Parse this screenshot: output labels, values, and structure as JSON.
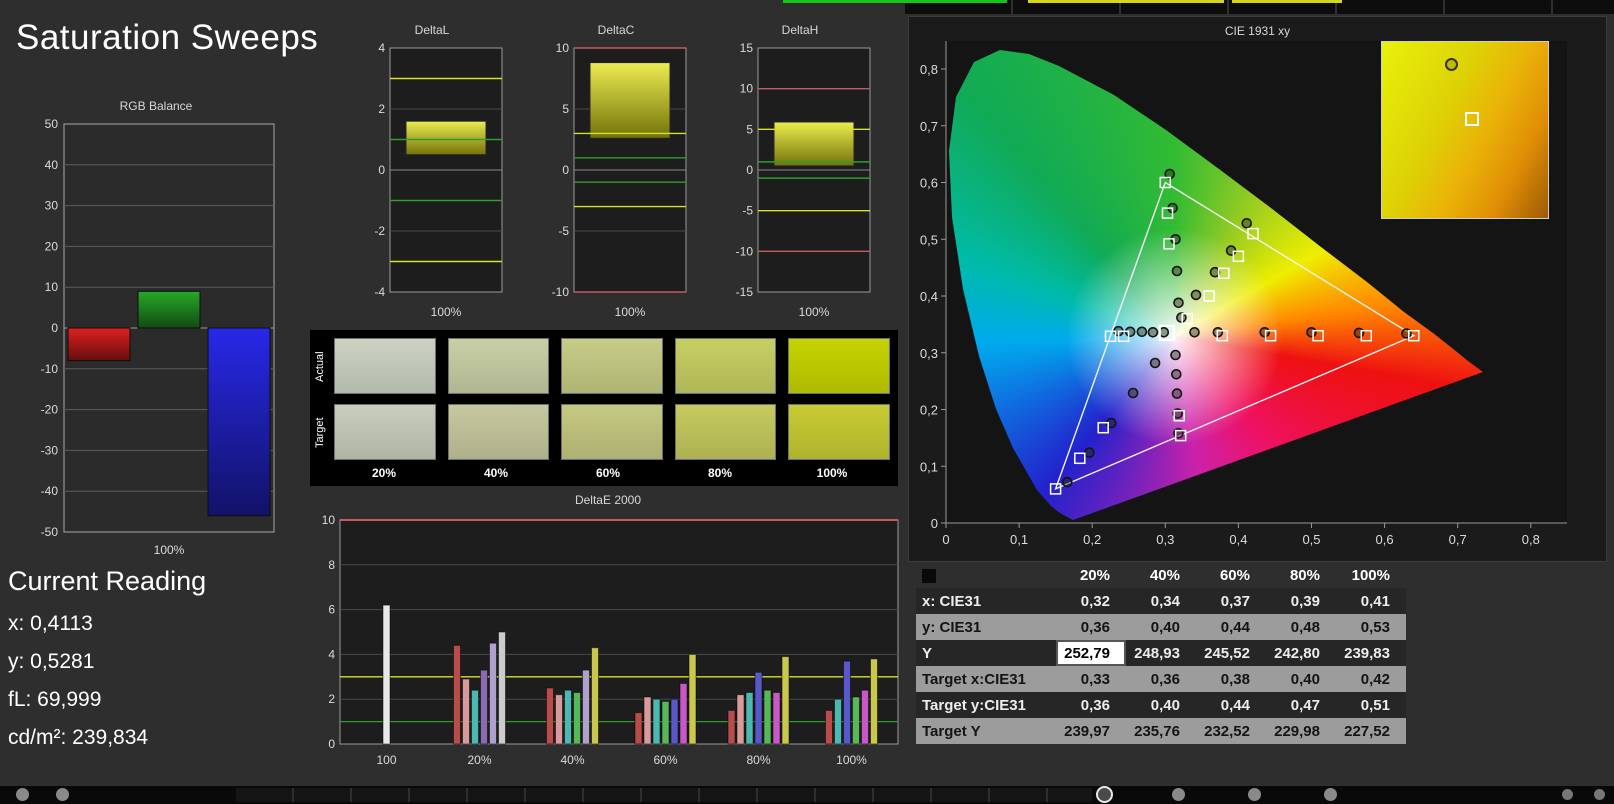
{
  "page": {
    "title": "Saturation Sweeps"
  },
  "current_reading": {
    "heading": "Current Reading",
    "lines": [
      "x: 0,4113",
      "y: 0,5281",
      "fL: 69,999",
      "cd/m²: 239,834"
    ]
  },
  "chart_data": [
    {
      "type": "bar",
      "title": "RGB Balance",
      "categories": [
        "Red",
        "Green",
        "Blue"
      ],
      "values": [
        -8,
        9,
        -46
      ],
      "colors": [
        "#e02020",
        "#28a828",
        "#2828e8"
      ],
      "ylim": [
        -50,
        50
      ],
      "ytick": 10,
      "xlabel": "100%"
    },
    {
      "type": "range-bar",
      "title": "DeltaL",
      "ylim": [
        -4,
        4
      ],
      "ytick": 2,
      "bar": [
        0.5,
        1.6
      ],
      "refs": [
        {
          "value": 3,
          "color": "yellow"
        },
        {
          "value": -3,
          "color": "yellow"
        },
        {
          "value": 1,
          "color": "green"
        },
        {
          "value": -1,
          "color": "green"
        }
      ],
      "xlabel": "100%"
    },
    {
      "type": "range-bar",
      "title": "DeltaC",
      "ylim": [
        -10,
        10
      ],
      "ytick": 5,
      "bar": [
        2.6,
        8.8
      ],
      "refs": [
        {
          "value": 10,
          "color": "red"
        },
        {
          "value": -10,
          "color": "red"
        },
        {
          "value": 3,
          "color": "yellow"
        },
        {
          "value": -3,
          "color": "yellow"
        },
        {
          "value": 1,
          "color": "green"
        },
        {
          "value": -1,
          "color": "green"
        }
      ],
      "xlabel": "100%"
    },
    {
      "type": "range-bar",
      "title": "DeltaH",
      "ylim": [
        -15,
        15
      ],
      "ytick": 5,
      "bar": [
        0.5,
        5.9
      ],
      "refs": [
        {
          "value": 10,
          "color": "red"
        },
        {
          "value": -10,
          "color": "red"
        },
        {
          "value": 5,
          "color": "yellow"
        },
        {
          "value": -5,
          "color": "yellow"
        },
        {
          "value": 1,
          "color": "green"
        },
        {
          "value": -1,
          "color": "green"
        }
      ],
      "xlabel": "100%"
    },
    {
      "type": "table",
      "title": "Saturation Swatches",
      "row_labels": [
        "Actual",
        "Target"
      ],
      "col_labels": [
        "20%",
        "40%",
        "60%",
        "80%",
        "100%"
      ],
      "actual_colors": [
        "#ccd3c3",
        "#c9cfa5",
        "#c7cd86",
        "#c7cf63",
        "#c6d400"
      ],
      "target_colors": [
        "#c9cdbb",
        "#c6c99e",
        "#c5c981",
        "#c6ca5e",
        "#c7cc33"
      ]
    },
    {
      "type": "bar",
      "title": "DeltaE 2000",
      "ylim": [
        0,
        10
      ],
      "ytick": 2,
      "refs": [
        {
          "value": 10,
          "color": "red"
        },
        {
          "value": 3,
          "color": "yellow"
        },
        {
          "value": 1,
          "color": "green"
        }
      ],
      "groups": [
        {
          "label": "100",
          "bars": [
            {
              "color": "#e8e8e8",
              "value": 6.2
            }
          ]
        },
        {
          "label": "20%",
          "bars": [
            {
              "color": "#b84c4c",
              "value": 4.4
            },
            {
              "color": "#d89b9b",
              "value": 2.9
            },
            {
              "color": "#4cb8b0",
              "value": 2.4
            },
            {
              "color": "#8a6ab0",
              "value": 3.3
            },
            {
              "color": "#b0a0cc",
              "value": 4.5
            },
            {
              "color": "#cccccc",
              "value": 5.0
            }
          ]
        },
        {
          "label": "40%",
          "bars": [
            {
              "color": "#b84c4c",
              "value": 2.5
            },
            {
              "color": "#d89b9b",
              "value": 2.2
            },
            {
              "color": "#4cb8b0",
              "value": 2.4
            },
            {
              "color": "#58b858",
              "value": 2.3
            },
            {
              "color": "#b0a0cc",
              "value": 3.3
            },
            {
              "color": "#c8c84c",
              "value": 4.3
            }
          ]
        },
        {
          "label": "60%",
          "bars": [
            {
              "color": "#b84c4c",
              "value": 1.4
            },
            {
              "color": "#d89b9b",
              "value": 2.1
            },
            {
              "color": "#4cb8b0",
              "value": 2.0
            },
            {
              "color": "#58b858",
              "value": 1.9
            },
            {
              "color": "#5858c8",
              "value": 2.0
            },
            {
              "color": "#c858c8",
              "value": 2.7
            },
            {
              "color": "#c8c84c",
              "value": 4.0
            }
          ]
        },
        {
          "label": "80%",
          "bars": [
            {
              "color": "#b84c4c",
              "value": 1.5
            },
            {
              "color": "#d89b9b",
              "value": 2.2
            },
            {
              "color": "#4cb8b0",
              "value": 2.3
            },
            {
              "color": "#5858c8",
              "value": 3.2
            },
            {
              "color": "#58b858",
              "value": 2.4
            },
            {
              "color": "#c858c8",
              "value": 2.3
            },
            {
              "color": "#c8c84c",
              "value": 3.9
            }
          ]
        },
        {
          "label": "100%",
          "bars": [
            {
              "color": "#b84c4c",
              "value": 1.5
            },
            {
              "color": "#4cb8b0",
              "value": 2.0
            },
            {
              "color": "#5858c8",
              "value": 3.7
            },
            {
              "color": "#58b858",
              "value": 2.1
            },
            {
              "color": "#c858c8",
              "value": 2.4
            },
            {
              "color": "#c8c84c",
              "value": 3.8
            }
          ]
        }
      ]
    },
    {
      "type": "scatter",
      "title": "CIE 1931 xy",
      "xlim": [
        0,
        0.85
      ],
      "ylim": [
        0,
        0.85
      ],
      "xtick_labels": [
        "0",
        "0,1",
        "0,2",
        "0,3",
        "0,4",
        "0,5",
        "0,6",
        "0,7",
        "0,8"
      ],
      "ytick_labels": [
        "0",
        "0,1",
        "0,2",
        "0,3",
        "0,4",
        "0,5",
        "0,6",
        "0,7",
        "0,8"
      ],
      "gamut_triangle": [
        [
          0.64,
          0.33
        ],
        [
          0.3,
          0.6
        ],
        [
          0.15,
          0.06
        ]
      ],
      "measured_points": [
        [
          0.34,
          0.336
        ],
        [
          0.372,
          0.336
        ],
        [
          0.436,
          0.336
        ],
        [
          0.5,
          0.336
        ],
        [
          0.565,
          0.335
        ],
        [
          0.63,
          0.334
        ],
        [
          0.318,
          0.388
        ],
        [
          0.316,
          0.444
        ],
        [
          0.314,
          0.5
        ],
        [
          0.31,
          0.555
        ],
        [
          0.306,
          0.615
        ],
        [
          0.286,
          0.282
        ],
        [
          0.256,
          0.229
        ],
        [
          0.226,
          0.176
        ],
        [
          0.196,
          0.124
        ],
        [
          0.166,
          0.072
        ],
        [
          0.298,
          0.336
        ],
        [
          0.283,
          0.336
        ],
        [
          0.268,
          0.337
        ],
        [
          0.252,
          0.337
        ],
        [
          0.236,
          0.338
        ],
        [
          0.314,
          0.296
        ],
        [
          0.315,
          0.262
        ],
        [
          0.316,
          0.228
        ],
        [
          0.317,
          0.193
        ],
        [
          0.318,
          0.158
        ],
        [
          0.322,
          0.362
        ],
        [
          0.342,
          0.402
        ],
        [
          0.368,
          0.442
        ],
        [
          0.39,
          0.48
        ],
        [
          0.4113,
          0.5281
        ]
      ],
      "target_points": [
        [
          0.378,
          0.33
        ],
        [
          0.444,
          0.33
        ],
        [
          0.509,
          0.33
        ],
        [
          0.575,
          0.33
        ],
        [
          0.64,
          0.33
        ],
        [
          0.305,
          0.492
        ],
        [
          0.303,
          0.546
        ],
        [
          0.3,
          0.6
        ],
        [
          0.215,
          0.168
        ],
        [
          0.183,
          0.114
        ],
        [
          0.15,
          0.06
        ],
        [
          0.243,
          0.329
        ],
        [
          0.225,
          0.329
        ],
        [
          0.319,
          0.189
        ],
        [
          0.321,
          0.154
        ],
        [
          0.33,
          0.36
        ],
        [
          0.36,
          0.4
        ],
        [
          0.38,
          0.44
        ],
        [
          0.4,
          0.47
        ],
        [
          0.42,
          0.51
        ]
      ],
      "current_point": [
        0.302,
        0.335
      ]
    }
  ],
  "measurement_table": {
    "columns": [
      "20%",
      "40%",
      "60%",
      "80%",
      "100%"
    ],
    "rows": [
      {
        "label": "x: CIE31",
        "values": [
          "0,32",
          "0,34",
          "0,37",
          "0,39",
          "0,41"
        ]
      },
      {
        "label": "y: CIE31",
        "values": [
          "0,36",
          "0,40",
          "0,44",
          "0,48",
          "0,53"
        ]
      },
      {
        "label": "Y",
        "values": [
          "252,79",
          "248,93",
          "245,52",
          "242,80",
          "239,83"
        ],
        "highlight_col": 0
      },
      {
        "label": "Target x:CIE31",
        "values": [
          "0,33",
          "0,36",
          "0,38",
          "0,40",
          "0,42"
        ]
      },
      {
        "label": "Target y:CIE31",
        "values": [
          "0,36",
          "0,40",
          "0,44",
          "0,47",
          "0,51"
        ]
      },
      {
        "label": "Target Y",
        "values": [
          "239,97",
          "235,76",
          "232,52",
          "229,98",
          "227,52"
        ]
      }
    ]
  }
}
